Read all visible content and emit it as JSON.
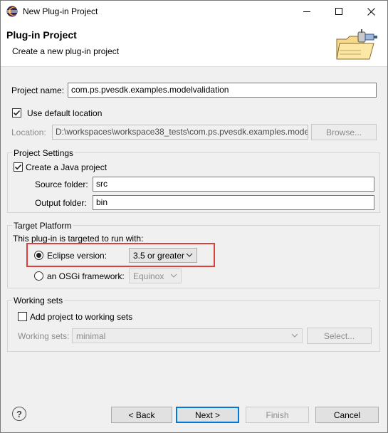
{
  "window": {
    "title": "New Plug-in Project",
    "controls": {
      "minimize": "minimize-icon",
      "maximize": "maximize-icon",
      "close": "close-icon"
    }
  },
  "banner": {
    "title": "Plug-in Project",
    "description": "Create a new plug-in project"
  },
  "project": {
    "name_label": "Project name:",
    "name_value": "com.ps.pvesdk.examples.modelvalidation",
    "use_default_label": "Use default location",
    "use_default_checked": true,
    "location_label": "Location:",
    "location_value": "D:\\workspaces\\workspace38_tests\\com.ps.pvesdk.examples.model",
    "browse_label": "Browse..."
  },
  "project_settings": {
    "title": "Project Settings",
    "java_label": "Create a Java project",
    "java_checked": true,
    "source_label": "Source folder:",
    "source_value": "src",
    "output_label": "Output folder:",
    "output_value": "bin"
  },
  "target_platform": {
    "title": "Target Platform",
    "intro": "This plug-in is targeted to run with:",
    "eclipse_label": "Eclipse version:",
    "eclipse_selected": true,
    "eclipse_value": "3.5 or greater",
    "osgi_label": "an OSGi framework:",
    "osgi_value": "Equinox"
  },
  "working_sets": {
    "title": "Working sets",
    "add_label": "Add project to working sets",
    "add_checked": false,
    "sets_label": "Working sets:",
    "sets_value": "minimal",
    "select_label": "Select..."
  },
  "footer": {
    "help_icon": "help-icon",
    "back_label": "< Back",
    "next_label": "Next >",
    "finish_label": "Finish",
    "cancel_label": "Cancel"
  },
  "colors": {
    "highlight": "#d9413a",
    "default_button": "#0078d7"
  }
}
